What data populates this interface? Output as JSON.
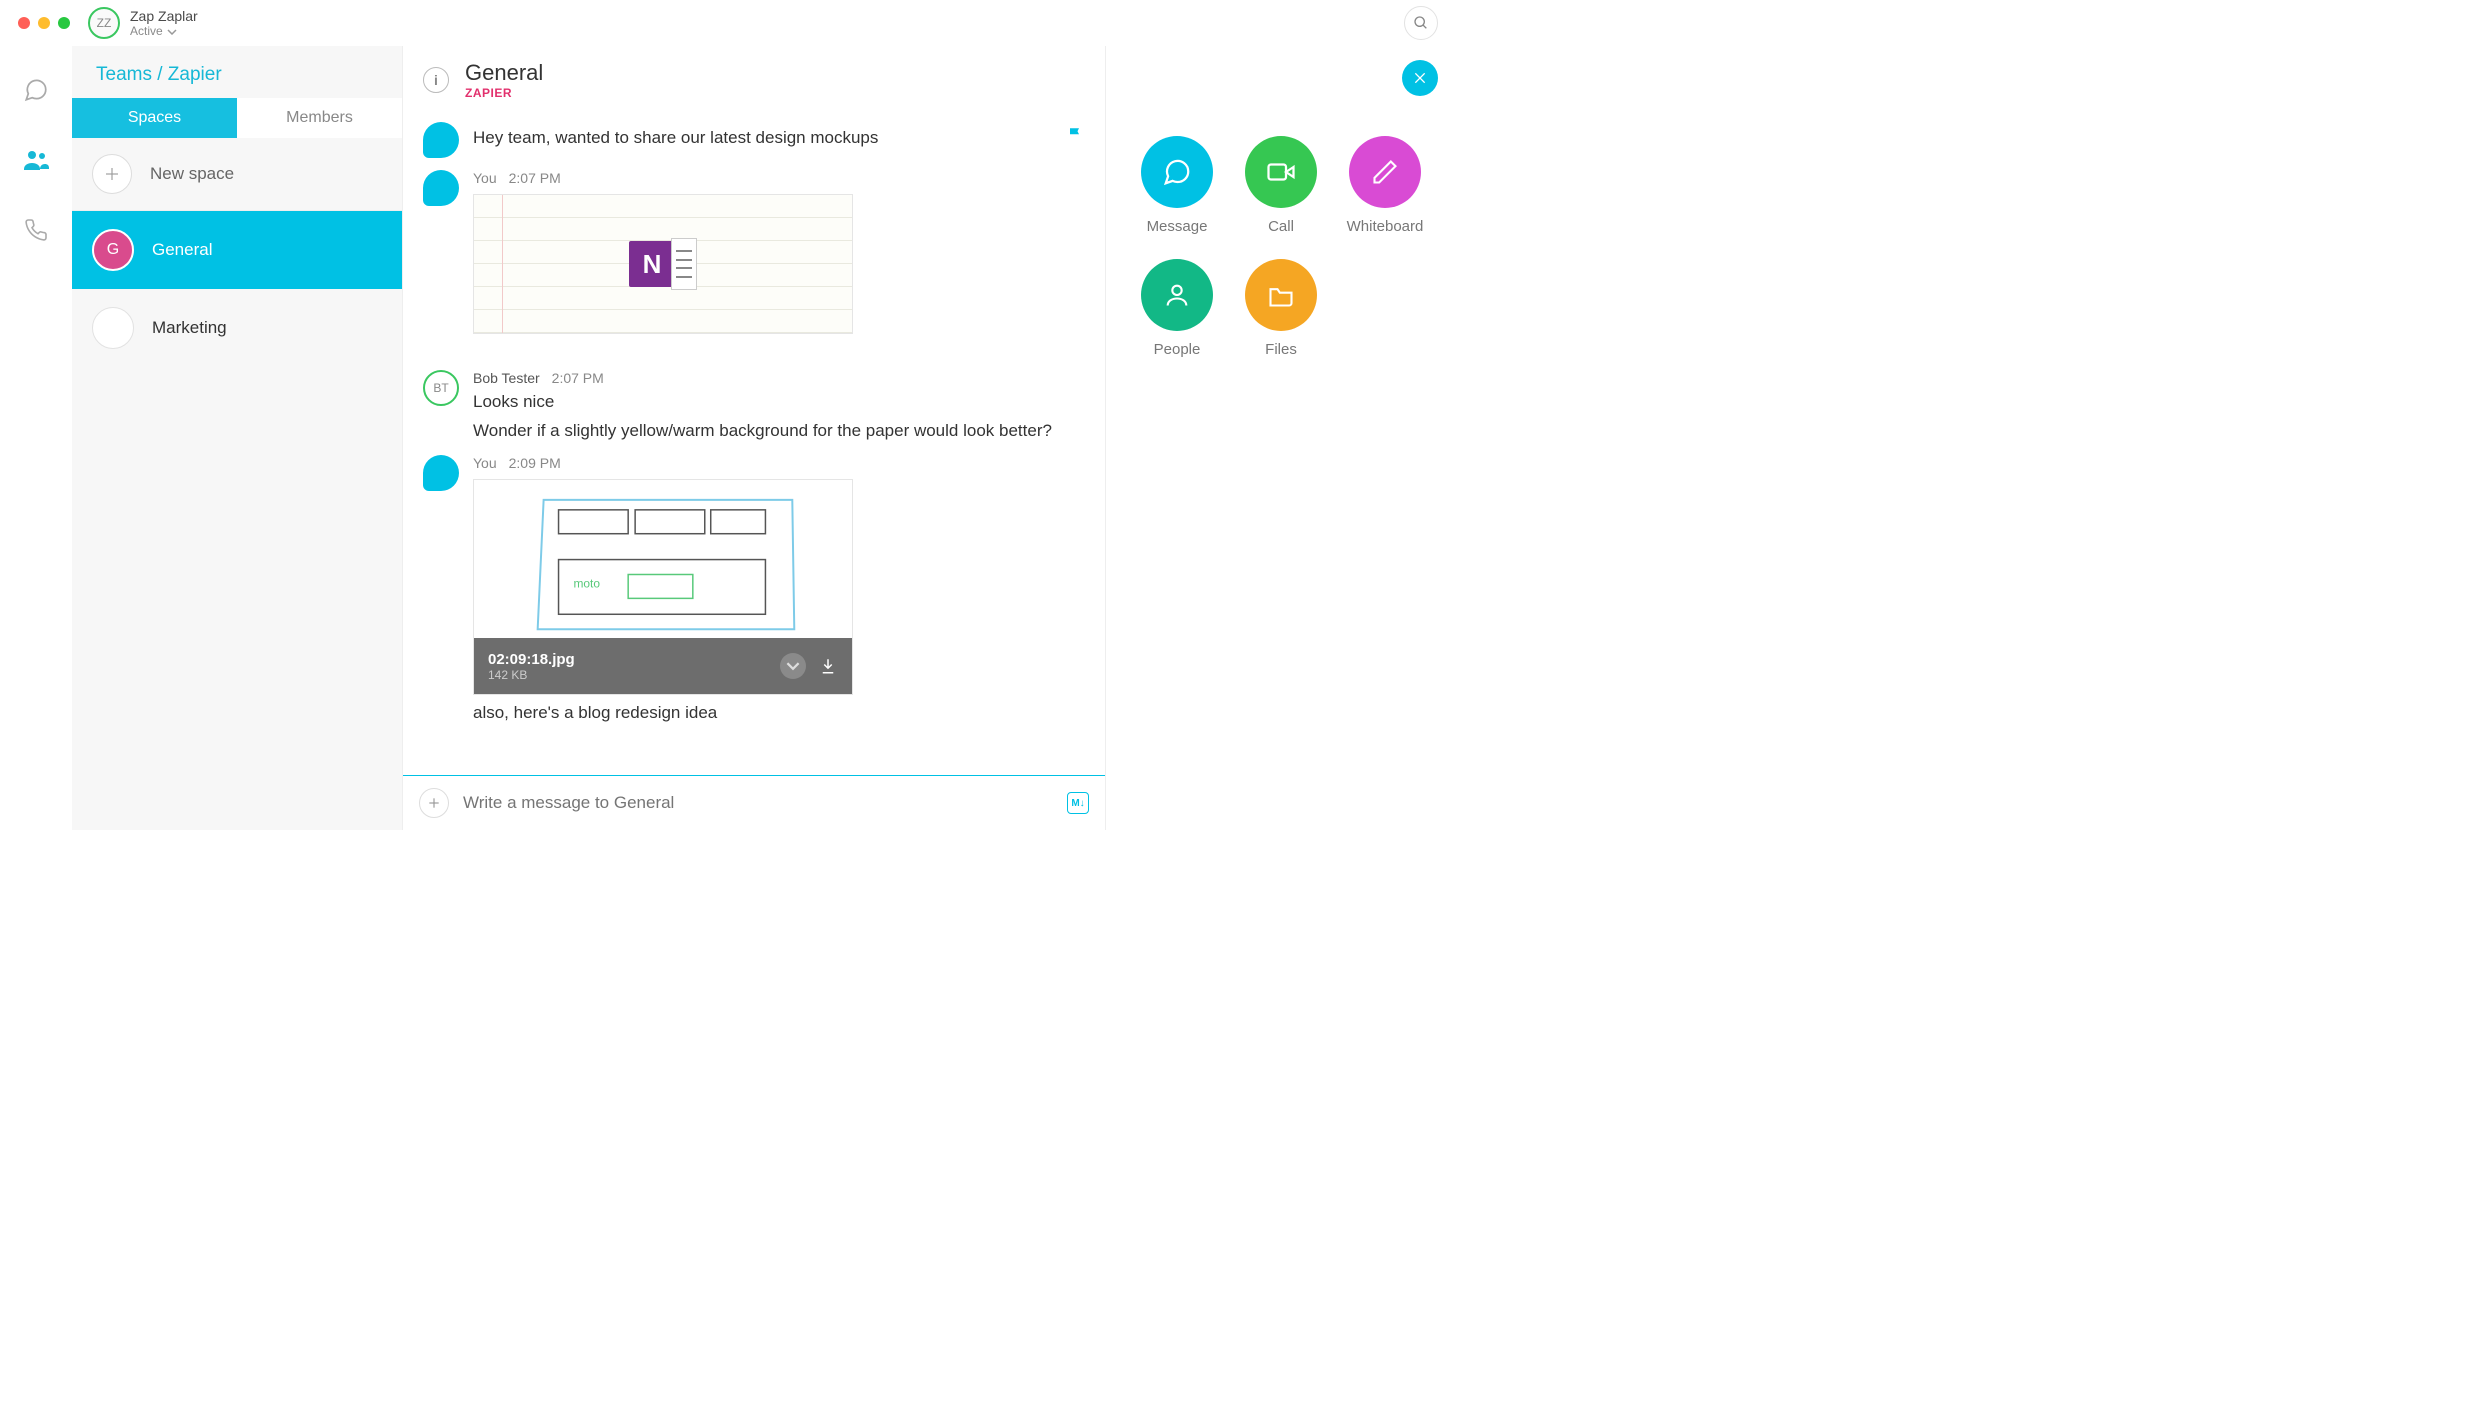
{
  "titlebar": {
    "user_initials": "ZZ",
    "user_name": "Zap Zaplar",
    "user_status": "Active"
  },
  "sidebar": {
    "breadcrumb": "Teams / Zapier",
    "tabs": {
      "spaces": "Spaces",
      "members": "Members"
    },
    "new_space": "New space",
    "spaces": [
      {
        "initial": "G",
        "name": "General",
        "active": true
      },
      {
        "initial": "*",
        "name": "Marketing",
        "active": false
      }
    ]
  },
  "chat": {
    "title": "General",
    "subtitle": "ZAPIER",
    "messages": [
      {
        "sender": "",
        "time": "",
        "text": "Hey team, wanted to share our latest design mockups",
        "flagged": true,
        "avatar": "you"
      },
      {
        "sender": "You",
        "time": "2:07 PM",
        "text": "",
        "avatar": "you",
        "attachment": "onenote"
      },
      {
        "sender": "Bob Tester",
        "time": "2:07 PM",
        "initials": "BT",
        "avatar": "bob",
        "lines": [
          "Looks nice",
          "Wonder if a slightly yellow/warm background for the paper would look better?"
        ]
      },
      {
        "sender": "You",
        "time": "2:09 PM",
        "avatar": "you",
        "attachment": "sketch",
        "filename": "02:09:18.jpg",
        "filesize": "142 KB",
        "trailing": "also, here's a blog redesign idea"
      }
    ],
    "composer_placeholder": "Write a message to General"
  },
  "rightpanel": {
    "actions": [
      {
        "key": "message",
        "label": "Message"
      },
      {
        "key": "call",
        "label": "Call"
      },
      {
        "key": "whiteboard",
        "label": "Whiteboard"
      },
      {
        "key": "people",
        "label": "People"
      },
      {
        "key": "files",
        "label": "Files"
      }
    ]
  }
}
